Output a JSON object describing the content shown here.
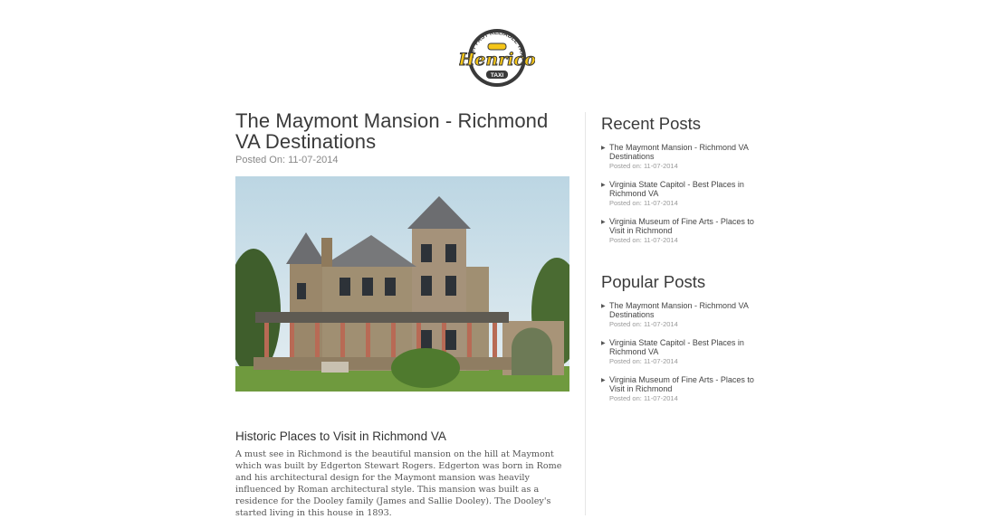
{
  "logo": {
    "brand": "Henrico",
    "tagline": "24/7 FAST RELIABLE TAXI",
    "sub": "TAXI"
  },
  "post": {
    "title": "The Maymont Mansion - Richmond VA Destinations",
    "meta": "Posted On: 11-07-2014",
    "section_heading": "Historic Places to Visit in Richmond VA",
    "body": "A must see in Richmond is the beautiful mansion on the hill at Maymont which was built by Edgerton Stewart Rogers. Edgerton was born in Rome and his architectural design for the Maymont mansion was heavily influenced by Roman architectural style. This mansion was built as a residence for the Dooley family (James and Sallie Dooley). The Dooley's started living in this house in 1893."
  },
  "sidebar": {
    "recent_heading": "Recent Posts",
    "recent": [
      {
        "title": "The Maymont Mansion - Richmond VA Destinations",
        "date": "Posted on: 11-07-2014"
      },
      {
        "title": "Virginia State Capitol - Best Places in Richmond VA",
        "date": "Posted on: 11-07-2014"
      },
      {
        "title": "Virginia Museum of Fine Arts - Places to Visit in Richmond",
        "date": "Posted on: 11-07-2014"
      }
    ],
    "popular_heading": "Popular Posts",
    "popular": [
      {
        "title": "The Maymont Mansion - Richmond VA Destinations",
        "date": "Posted on: 11-07-2014"
      },
      {
        "title": "Virginia State Capitol - Best Places in Richmond VA",
        "date": "Posted on: 11-07-2014"
      },
      {
        "title": "Virginia Museum of Fine Arts - Places to Visit in Richmond",
        "date": "Posted on: 11-07-2014"
      }
    ]
  },
  "colors": {
    "logo_yellow": "#f5c518",
    "logo_dark": "#3a3a3a",
    "sky": "#cfe4ee",
    "stone": "#a08f72",
    "grass": "#6f9a3e"
  }
}
